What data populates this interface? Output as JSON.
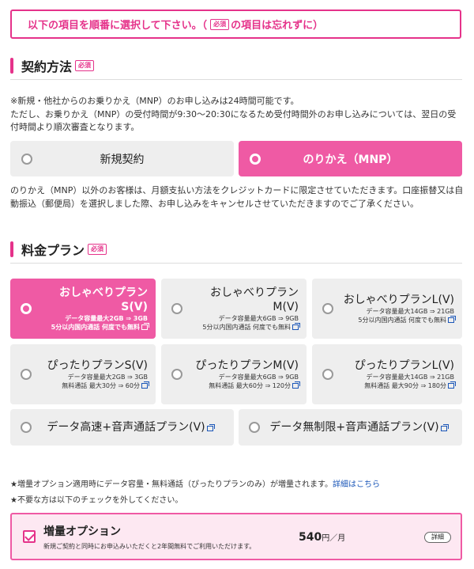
{
  "notice": {
    "before": "以下の項目を順番に選択して下さい。（",
    "req": "必須",
    "after": "の項目は忘れずに）"
  },
  "contract": {
    "title": "契約方法",
    "req": "必須",
    "note1": "※新規・他社からのお乗りかえ（MNP）のお申し込みは24時間可能です。",
    "note2": "ただし、お乗りかえ（MNP）の受付時間が9:30〜20:30になるため受付時間外のお申し込みについては、翌日の受付時間より順次審査となります。",
    "options": [
      {
        "label": "新規契約",
        "selected": false
      },
      {
        "label": "のりかえ（MNP）",
        "selected": true
      }
    ],
    "after_note": "のりかえ（MNP）以外のお客様は、月額支払い方法をクレジットカードに限定させていただきます。口座振替又は自動振込（郵便局）を選択しました際、お申し込みをキャンセルさせていただきますのでご了承ください。"
  },
  "plan": {
    "title": "料金プラン",
    "req": "必須",
    "items": [
      {
        "name": "おしゃべりプランS(V)",
        "sub1": "データ容量最大2GB ⇒ 3GB",
        "sub2": "5分以内国内通話 何度でも無料",
        "selected": true
      },
      {
        "name": "おしゃべりプランM(V)",
        "sub1": "データ容量最大6GB ⇒ 9GB",
        "sub2": "5分以内国内通話 何度でも無料",
        "selected": false
      },
      {
        "name": "おしゃべりプランL(V)",
        "sub1": "データ容量最大14GB ⇒ 21GB",
        "sub2": "5分以内国内通話 何度でも無料",
        "selected": false
      },
      {
        "name": "ぴったりプランS(V)",
        "sub1": "データ容量最大2GB ⇒ 3GB",
        "sub2": "無料通話 最大30分 ⇒ 60分",
        "selected": false
      },
      {
        "name": "ぴったりプランM(V)",
        "sub1": "データ容量最大6GB ⇒ 9GB",
        "sub2": "無料通話 最大60分 ⇒ 120分",
        "selected": false
      },
      {
        "name": "ぴったりプランL(V)",
        "sub1": "データ容量最大14GB ⇒ 21GB",
        "sub2": "無料通話 最大90分 ⇒ 180分",
        "selected": false
      },
      {
        "name": "データ高速+音声通話プラン(V)",
        "selected": false
      },
      {
        "name": "データ無制限+音声通話プラン(V)",
        "selected": false
      }
    ]
  },
  "notes": {
    "line1": "★増量オプション適用時にデータ容量・無料通話（ぴったりプランのみ）が増量されます。",
    "line1_link": "詳細はこちら",
    "line2": "★不要な方は以下のチェックを外してください。"
  },
  "option": {
    "title": "増量オプション",
    "desc": "新規ご契約と同時にお申込みいただくと2年間無料でご利用いただけます。",
    "price": "540",
    "unit": "円／月",
    "detail": "詳細",
    "checked": true
  },
  "colors": {
    "accent": "#e5328a",
    "selected_bg": "#ef5aa4",
    "option_bg": "#eeeeee"
  }
}
